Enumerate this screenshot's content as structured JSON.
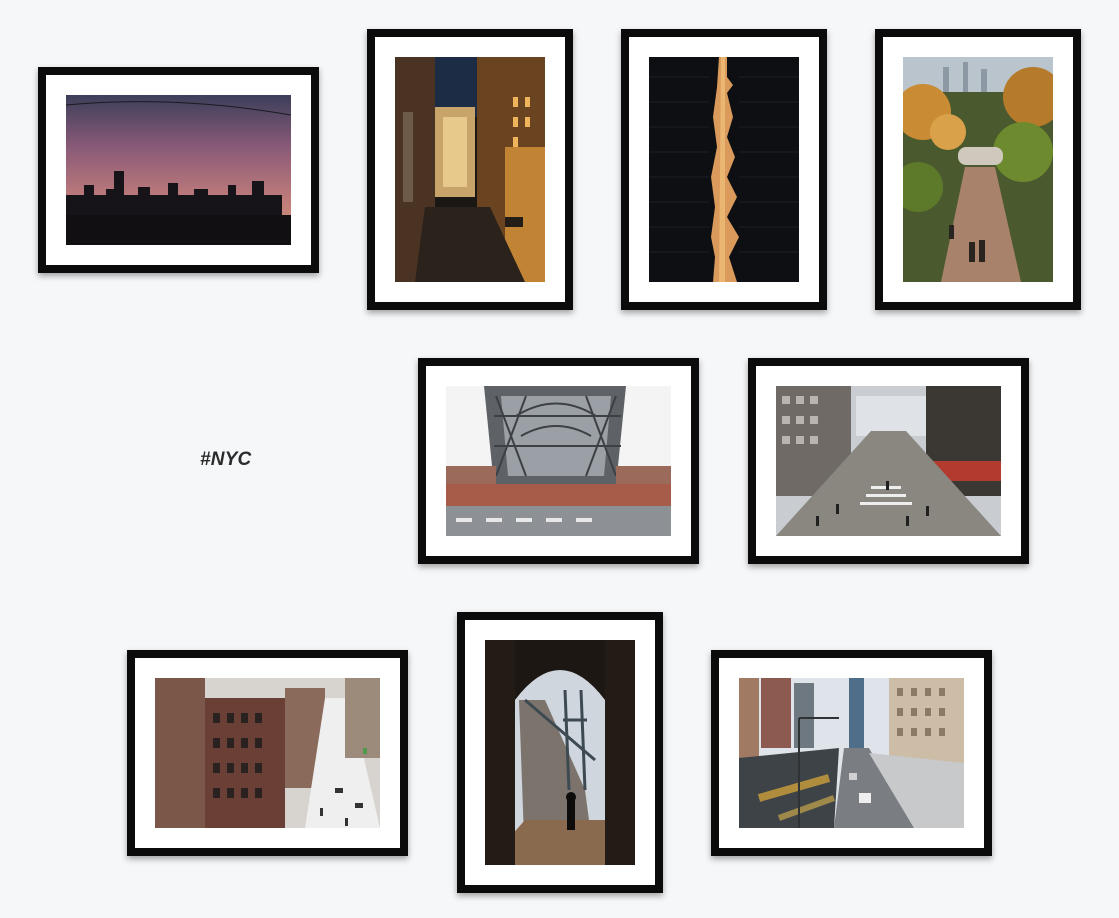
{
  "gallery": {
    "hashtag": "#NYC",
    "photos": [
      {
        "subject": "sunset-skyline-photo"
      },
      {
        "subject": "night-alley-photo"
      },
      {
        "subject": "building-sliver-light-photo"
      },
      {
        "subject": "autumn-park-path-photo"
      },
      {
        "subject": "bridge-underside-photo"
      },
      {
        "subject": "busy-street-crosswalk-photo"
      },
      {
        "subject": "brick-tenement-street-photo"
      },
      {
        "subject": "bridge-archway-silhouette-photo"
      },
      {
        "subject": "highway-traffic-motion-photo"
      }
    ]
  },
  "colors": {
    "background": "#f6f7f9",
    "frame": "#0b0b0b",
    "mat": "#ffffff",
    "caption": "#2b2b2b"
  }
}
